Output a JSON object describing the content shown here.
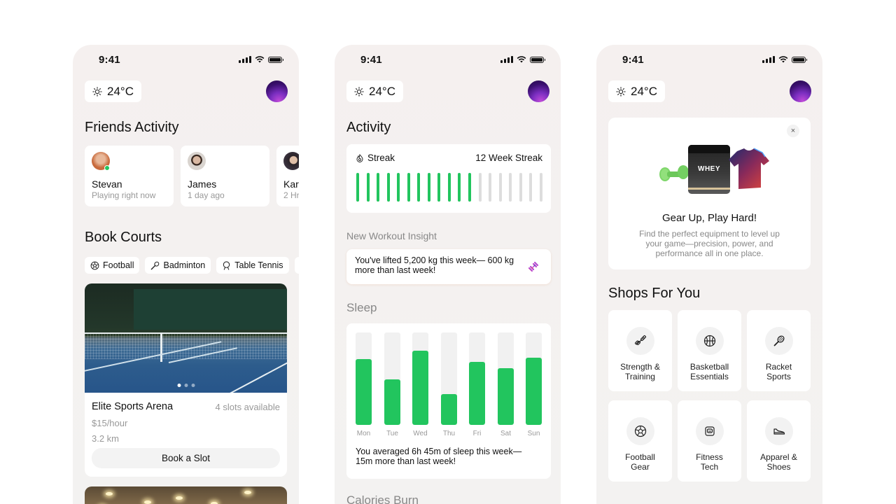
{
  "status_bar": {
    "time": "9:41"
  },
  "weather": {
    "icon": "sun-icon",
    "temperature": "24°C"
  },
  "screen1": {
    "friends_title": "Friends Activity",
    "friends": [
      {
        "name": "Stevan",
        "status": "Playing right now",
        "online": true,
        "avatar_color": "#c86a3c"
      },
      {
        "name": "James",
        "status": "1 day ago",
        "online": false,
        "avatar_color": "#d9d4cf"
      },
      {
        "name": "Kar",
        "status": "2 Hr",
        "online": false,
        "avatar_color": "#3b3340"
      }
    ],
    "courts_title": "Book Courts",
    "filters": [
      {
        "label": "Football",
        "icon": "football-icon"
      },
      {
        "label": "Badminton",
        "icon": "badminton-icon"
      },
      {
        "label": "Table Tennis",
        "icon": "table-tennis-icon"
      },
      {
        "label": "",
        "icon": ""
      }
    ],
    "court": {
      "name": "Elite Sports Arena",
      "slots": "4 slots available",
      "price": "$15/hour",
      "distance": "3.2 km",
      "book_label": "Book a Slot",
      "carousel_count": 3,
      "carousel_active": 0
    }
  },
  "screen2": {
    "activity_title": "Activity",
    "streak": {
      "label": "Streak",
      "icon": "flame-icon",
      "value": "12 Week Streak",
      "weeks_completed": 12,
      "weeks_total": 19
    },
    "insight_title": "New Workout Insight",
    "insight_text": "You've lifted 5,200 kg this week— 600 kg more than last week!",
    "insight_icon": "dumbbell-icon",
    "sleep_title": "Sleep",
    "sleep": {
      "days": [
        "Mon",
        "Tue",
        "Wed",
        "Thu",
        "Fri",
        "Sat",
        "Sun"
      ],
      "fill_fraction": [
        0.71,
        0.49,
        0.8,
        0.33,
        0.68,
        0.61,
        0.73
      ]
    },
    "sleep_text": "You averaged 6h 45m of sleep this week—15m more than last week!",
    "calories_title": "Calories Burn"
  },
  "screen3": {
    "promo": {
      "title": "Gear Up, Play Hard!",
      "description": "Find the perfect equipment to level up your game—precision, power, and performance all in one place.",
      "product_label": "WHEY",
      "close_label": "×"
    },
    "shops_title": "Shops For You",
    "shops": [
      {
        "label": "Strength &\nTraining",
        "icon": "dumbbell-icon"
      },
      {
        "label": "Basketball\nEssentials",
        "icon": "basketball-icon"
      },
      {
        "label": "Racket\nSports",
        "icon": "racket-icon"
      },
      {
        "label": "Football\nGear",
        "icon": "football-icon"
      },
      {
        "label": "Fitness\nTech",
        "icon": "fitness-tracker-icon"
      },
      {
        "label": "Apparel &\nShoes",
        "icon": "shoe-icon"
      }
    ]
  },
  "colors": {
    "accent_green": "#22c55e",
    "track_gray": "#f1f1f1",
    "muted_text": "#999999"
  }
}
